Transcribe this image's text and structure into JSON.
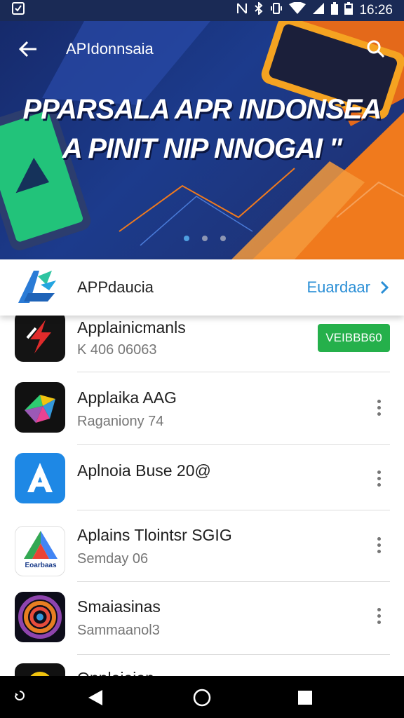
{
  "status_bar": {
    "time": "16:26",
    "icons": [
      "notification-icon",
      "nfc-icon",
      "bluetooth-icon",
      "vibrate-icon",
      "wifi-icon",
      "signal-icon",
      "battery-saver-icon",
      "battery-icon"
    ]
  },
  "header": {
    "title": "APIdonnsaia",
    "headline_line1": "PPARSALA APR INDONSEA",
    "headline_line2": "A PINIT NIP NNOGAI \"",
    "carousel_pages": 3,
    "carousel_active_index": 0
  },
  "featured": {
    "name": "APPdaucia",
    "link_label": "Euardaar"
  },
  "apps": [
    {
      "name": "Applainicmanls",
      "subtitle": "K 406 06063",
      "action": "VEIBBB60",
      "icon": "app-icon-red-bolt"
    },
    {
      "name": "Applaika AAG",
      "subtitle": "Raganiony 74",
      "icon": "app-icon-colorful"
    },
    {
      "name": "Aplnoia Buse 20@",
      "subtitle": "",
      "icon": "app-icon-blue-a"
    },
    {
      "name": "Aplains Tlointsr SGIG",
      "subtitle": "Semday 06",
      "icon": "app-icon-triangle",
      "icon_caption": "Eoarbaas"
    },
    {
      "name": "Smaiasinas",
      "subtitle": "Sammaanol3",
      "icon": "app-icon-spiral"
    },
    {
      "name": "Onplaiaian",
      "subtitle": "",
      "icon": "app-icon-yellow"
    }
  ],
  "colors": {
    "accent_blue": "#2b8fd6",
    "install_green": "#25b04b",
    "hero_navy": "#1c3b8c",
    "hero_orange": "#f07a1d"
  }
}
